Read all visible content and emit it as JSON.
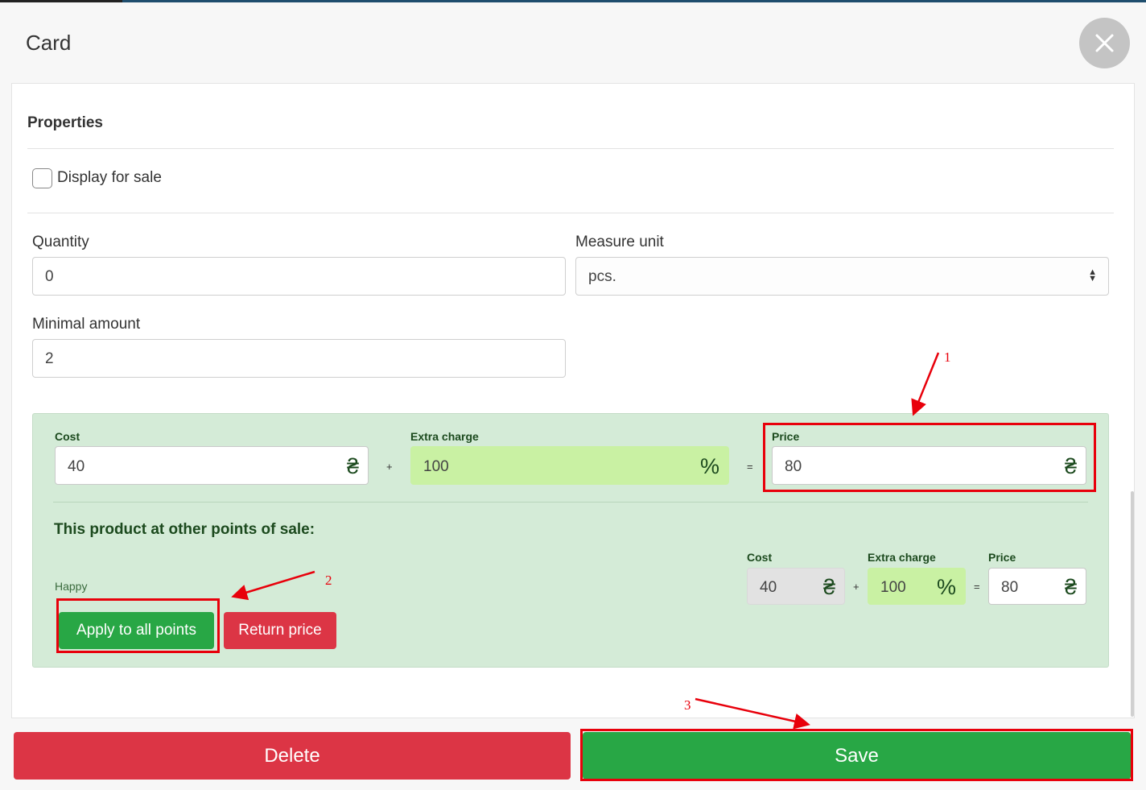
{
  "modal": {
    "title": "Card",
    "close_icon": "close-icon"
  },
  "properties": {
    "title": "Properties",
    "display_for_sale_label": "Display for sale",
    "display_for_sale_checked": false
  },
  "fields": {
    "quantity_label": "Quantity",
    "quantity_value": "0",
    "measure_unit_label": "Measure unit",
    "measure_unit_value": "pcs.",
    "minimal_amount_label": "Minimal amount",
    "minimal_amount_value": "2"
  },
  "pricing": {
    "cost_label": "Cost",
    "cost_value": "40",
    "extra_label": "Extra charge",
    "extra_value": "100",
    "price_label": "Price",
    "price_value": "80",
    "currency": "₴",
    "percent": "%",
    "plus": "+",
    "equals": "=",
    "other_points_title": "This product at other points of sale:",
    "point": {
      "name": "Happy",
      "cost_label": "Cost",
      "cost_value": "40",
      "extra_label": "Extra charge",
      "extra_value": "100",
      "price_label": "Price",
      "price_value": "80"
    },
    "apply_button": "Apply to all points",
    "return_button": "Return price"
  },
  "footer": {
    "delete_button": "Delete",
    "save_button": "Save"
  },
  "annotations": {
    "label_1": "1",
    "label_2": "2",
    "label_3": "3",
    "color": "#e8000b"
  },
  "colors": {
    "success": "#28a745",
    "danger": "#dc3545",
    "panel_green": "#d4ebd7",
    "input_green": "#c9f1a3",
    "dark_green_text": "#1c4a1e"
  }
}
